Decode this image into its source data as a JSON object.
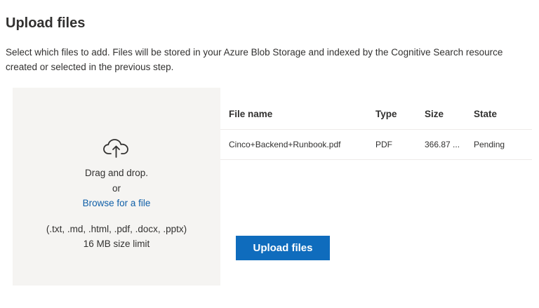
{
  "header": {
    "title": "Upload files",
    "description": "Select which files to add. Files will be stored in your Azure Blob Storage and indexed by the Cognitive Search resource created or selected in the previous step."
  },
  "dropzone": {
    "icon": "cloud-upload-icon",
    "drag_text": "Drag and drop.",
    "or_text": "or",
    "browse_link": "Browse for a file",
    "formats": "(.txt, .md, .html, .pdf, .docx, .pptx)",
    "size_limit": "16 MB size limit"
  },
  "table": {
    "columns": [
      "File name",
      "Type",
      "Size",
      "State"
    ],
    "rows": [
      [
        "Cinco+Backend+Runbook.pdf",
        "PDF",
        "366.87 ...",
        "Pending"
      ]
    ]
  },
  "actions": {
    "upload_label": "Upload files"
  },
  "colors": {
    "accent": "#0f6cbd",
    "link": "#0f5fa8",
    "dropzone_bg": "#f5f4f2"
  }
}
